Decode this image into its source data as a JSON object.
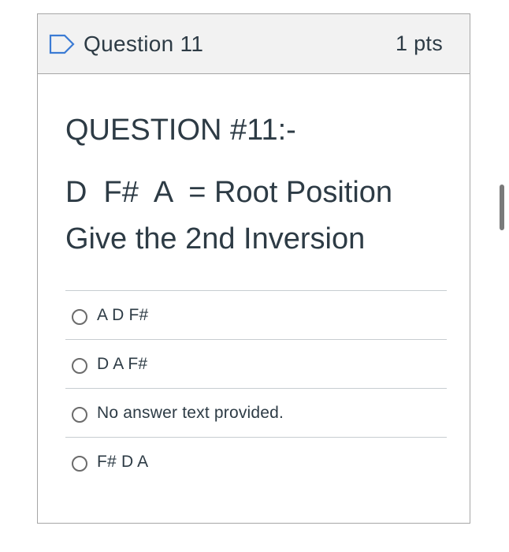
{
  "header": {
    "title": "Question 11",
    "points": "1 pts"
  },
  "question": {
    "heading": "QUESTION #11:-",
    "line1": "D  F#  A  = Root Position",
    "line2": "Give the 2nd Inversion"
  },
  "answers": [
    {
      "label": "A D F#"
    },
    {
      "label": "D A F#"
    },
    {
      "label": "No answer text provided."
    },
    {
      "label": "F# D A"
    }
  ],
  "colors": {
    "header_bg": "#f2f2f2",
    "border": "#a6a6a6",
    "flag_icon": "#3b7bd4",
    "text": "#2d3b45",
    "divider": "#c7cdd1"
  },
  "icons": {
    "flag": "bookmark-flag-icon",
    "radio": "radio-circle-icon"
  }
}
